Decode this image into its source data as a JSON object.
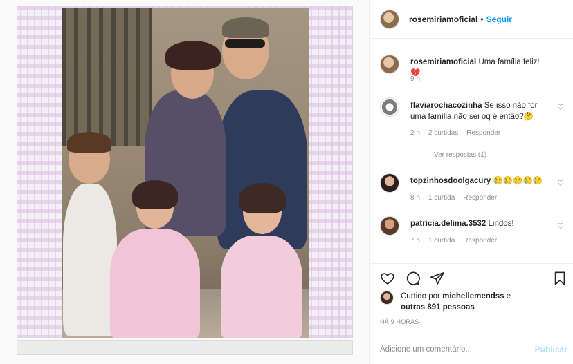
{
  "post": {
    "author": "rosemiriamoficial",
    "dot": "•",
    "follow_label": "Seguir"
  },
  "caption": {
    "author": "rosemiriamoficial",
    "text": "Uma família feliz!💔",
    "time": "9 h"
  },
  "comments": [
    {
      "author": "flaviarochacozinha",
      "text": "Se isso não for uma família não sei oq é então?🤔",
      "time": "2 h",
      "likes": "2 curtidas",
      "reply_label": "Responder",
      "view_replies": "Ver respostas (1)"
    },
    {
      "author": "topzinhosdoolgacury",
      "text": "😢😢😢😢😢",
      "time": "8 h",
      "likes": "1 curtida",
      "reply_label": "Responder"
    },
    {
      "author": "patricia.delima.3532",
      "text": "Lindos!",
      "time": "7 h",
      "likes": "1 curtida",
      "reply_label": "Responder"
    }
  ],
  "likes": {
    "prefix": "Curtido por",
    "user": "michellemendss",
    "connector": "e",
    "others": "outras 891 pessoas"
  },
  "timestamp": "HÁ 9 HORAS",
  "add_comment": {
    "placeholder": "Adicione um comentário...",
    "publish_label": "Publicar"
  },
  "icons": {
    "like": "heart-icon",
    "comment": "comment-icon",
    "share": "paper-plane-icon",
    "save": "bookmark-icon"
  }
}
